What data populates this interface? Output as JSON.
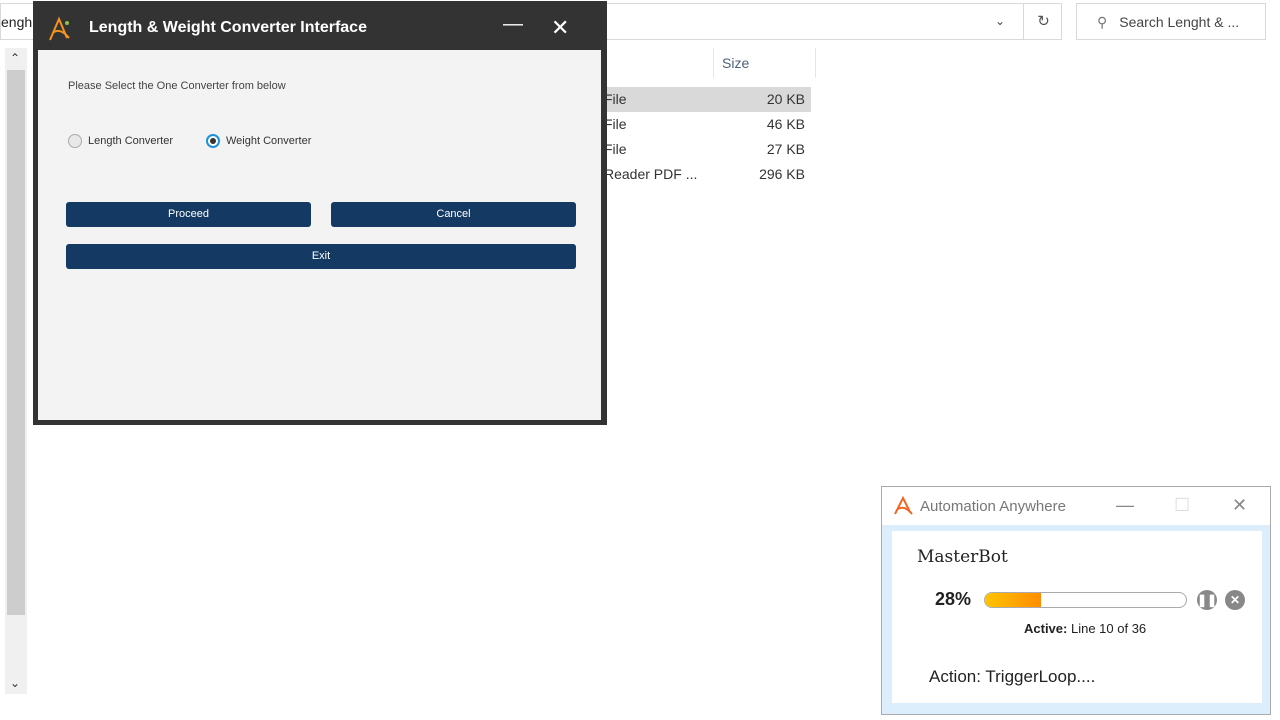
{
  "explorer": {
    "address_fragment": "engh",
    "search_placeholder": "Search Lenght & ...",
    "column_size": "Size",
    "rows": [
      {
        "type": "File",
        "size": "20 KB"
      },
      {
        "type": "File",
        "size": "46 KB"
      },
      {
        "type": "File",
        "size": "27 KB"
      },
      {
        "type": "Reader PDF ...",
        "size": "296 KB"
      }
    ]
  },
  "dialog": {
    "title": "Length & Weight Converter Interface",
    "prompt": "Please Select the One Converter from below",
    "options": [
      "Length Converter",
      "Weight Converter"
    ],
    "selected": "Weight Converter",
    "proceed": "Proceed",
    "cancel": "Cancel",
    "exit": "Exit"
  },
  "aa": {
    "title": "Automation Anywhere",
    "bot": "MasterBot",
    "percent_label": "28%",
    "progress": 0.28,
    "active_label": "Active:",
    "active_value": "Line 10 of 36",
    "action": "Action: TriggerLoop....",
    "accent": "#ff8c00"
  }
}
